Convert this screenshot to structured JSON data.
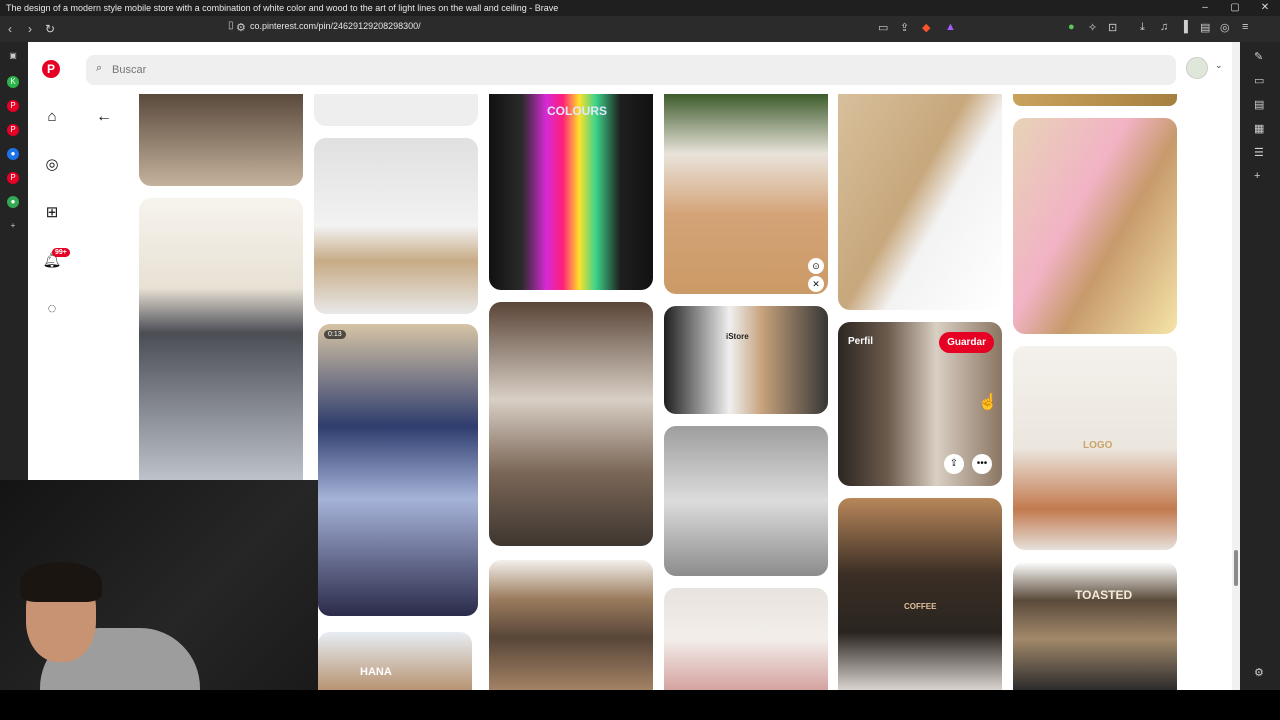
{
  "window": {
    "title": "The design of a modern style mobile store with a combination of white color and wood to the art of light lines on the wall and ceiling - Brave",
    "minimize": "–",
    "maximize": "▢",
    "close": "✕"
  },
  "address_bar": {
    "url": "co.pinterest.com/pin/24629129208298300/"
  },
  "search": {
    "placeholder": "Buscar"
  },
  "nav": {
    "notifications_badge": "99+"
  },
  "pins": [
    {
      "id": "store-counter",
      "colors": [
        "#6b5a4a",
        "#c7b39e"
      ]
    },
    {
      "id": "white-floor",
      "colors": [
        "#f0f0f0",
        "#dcdcdc"
      ]
    },
    {
      "id": "glass-display-case",
      "colors": [
        "#e9e9e9",
        "#b8a07d"
      ]
    },
    {
      "id": "colours-wall",
      "colors": [
        "#1d1d1d",
        "#f3c"
      ],
      "text": "COLOURS"
    },
    {
      "id": "plants-reception",
      "colors": [
        "#e7ded3",
        "#c48c5a"
      ]
    },
    {
      "id": "wall-install",
      "colors": [
        "#d9c2a1",
        "#f2f2f2"
      ]
    },
    {
      "id": "phone-cases-wall",
      "colors": [
        "#d4b892",
        "#f4b7c6"
      ]
    },
    {
      "id": "white-ceiling-store",
      "colors": [
        "#f6f6f2",
        "#c0c0c0"
      ]
    },
    {
      "id": "iphone-display",
      "duration": "0:13",
      "colors": [
        "#2e3a66",
        "#d9c6a6"
      ]
    },
    {
      "id": "wood-corridor",
      "colors": [
        "#7d6553",
        "#b09c8a"
      ]
    },
    {
      "id": "istore-interior",
      "colors": [
        "#2d2d2d",
        "#c9a27a"
      ],
      "text": "iStore"
    },
    {
      "id": "pharmacy-shelves",
      "colors": [
        "#5b4b40",
        "#d5cbc0"
      ],
      "hover_profile": "Perfil",
      "save_label": "Guardar"
    },
    {
      "id": "white-logo-office",
      "colors": [
        "#f1ede6",
        "#c37a4f"
      ],
      "text": "LOGO"
    },
    {
      "id": "metal-shelves",
      "colors": [
        "#8c8c8c",
        "#d6d6d6"
      ]
    },
    {
      "id": "coffee-shop",
      "colors": [
        "#3a2d22",
        "#b78a5c"
      ],
      "text": "COFFEE"
    },
    {
      "id": "toasted-front",
      "colors": [
        "#4a3a2b",
        "#a58a6d"
      ],
      "text": "TOASTED"
    },
    {
      "id": "hana-store",
      "colors": [
        "#dfe6ee",
        "#b69070"
      ],
      "text": "HANA"
    },
    {
      "id": "wood-cabinet",
      "colors": [
        "#9a7a5c",
        "#5c4636"
      ]
    },
    {
      "id": "white-arched-interior",
      "colors": [
        "#f1ece6",
        "#d9a3a0"
      ]
    },
    {
      "id": "top-strip",
      "colors": [
        "#c9a25d",
        "#a6803e"
      ]
    }
  ]
}
